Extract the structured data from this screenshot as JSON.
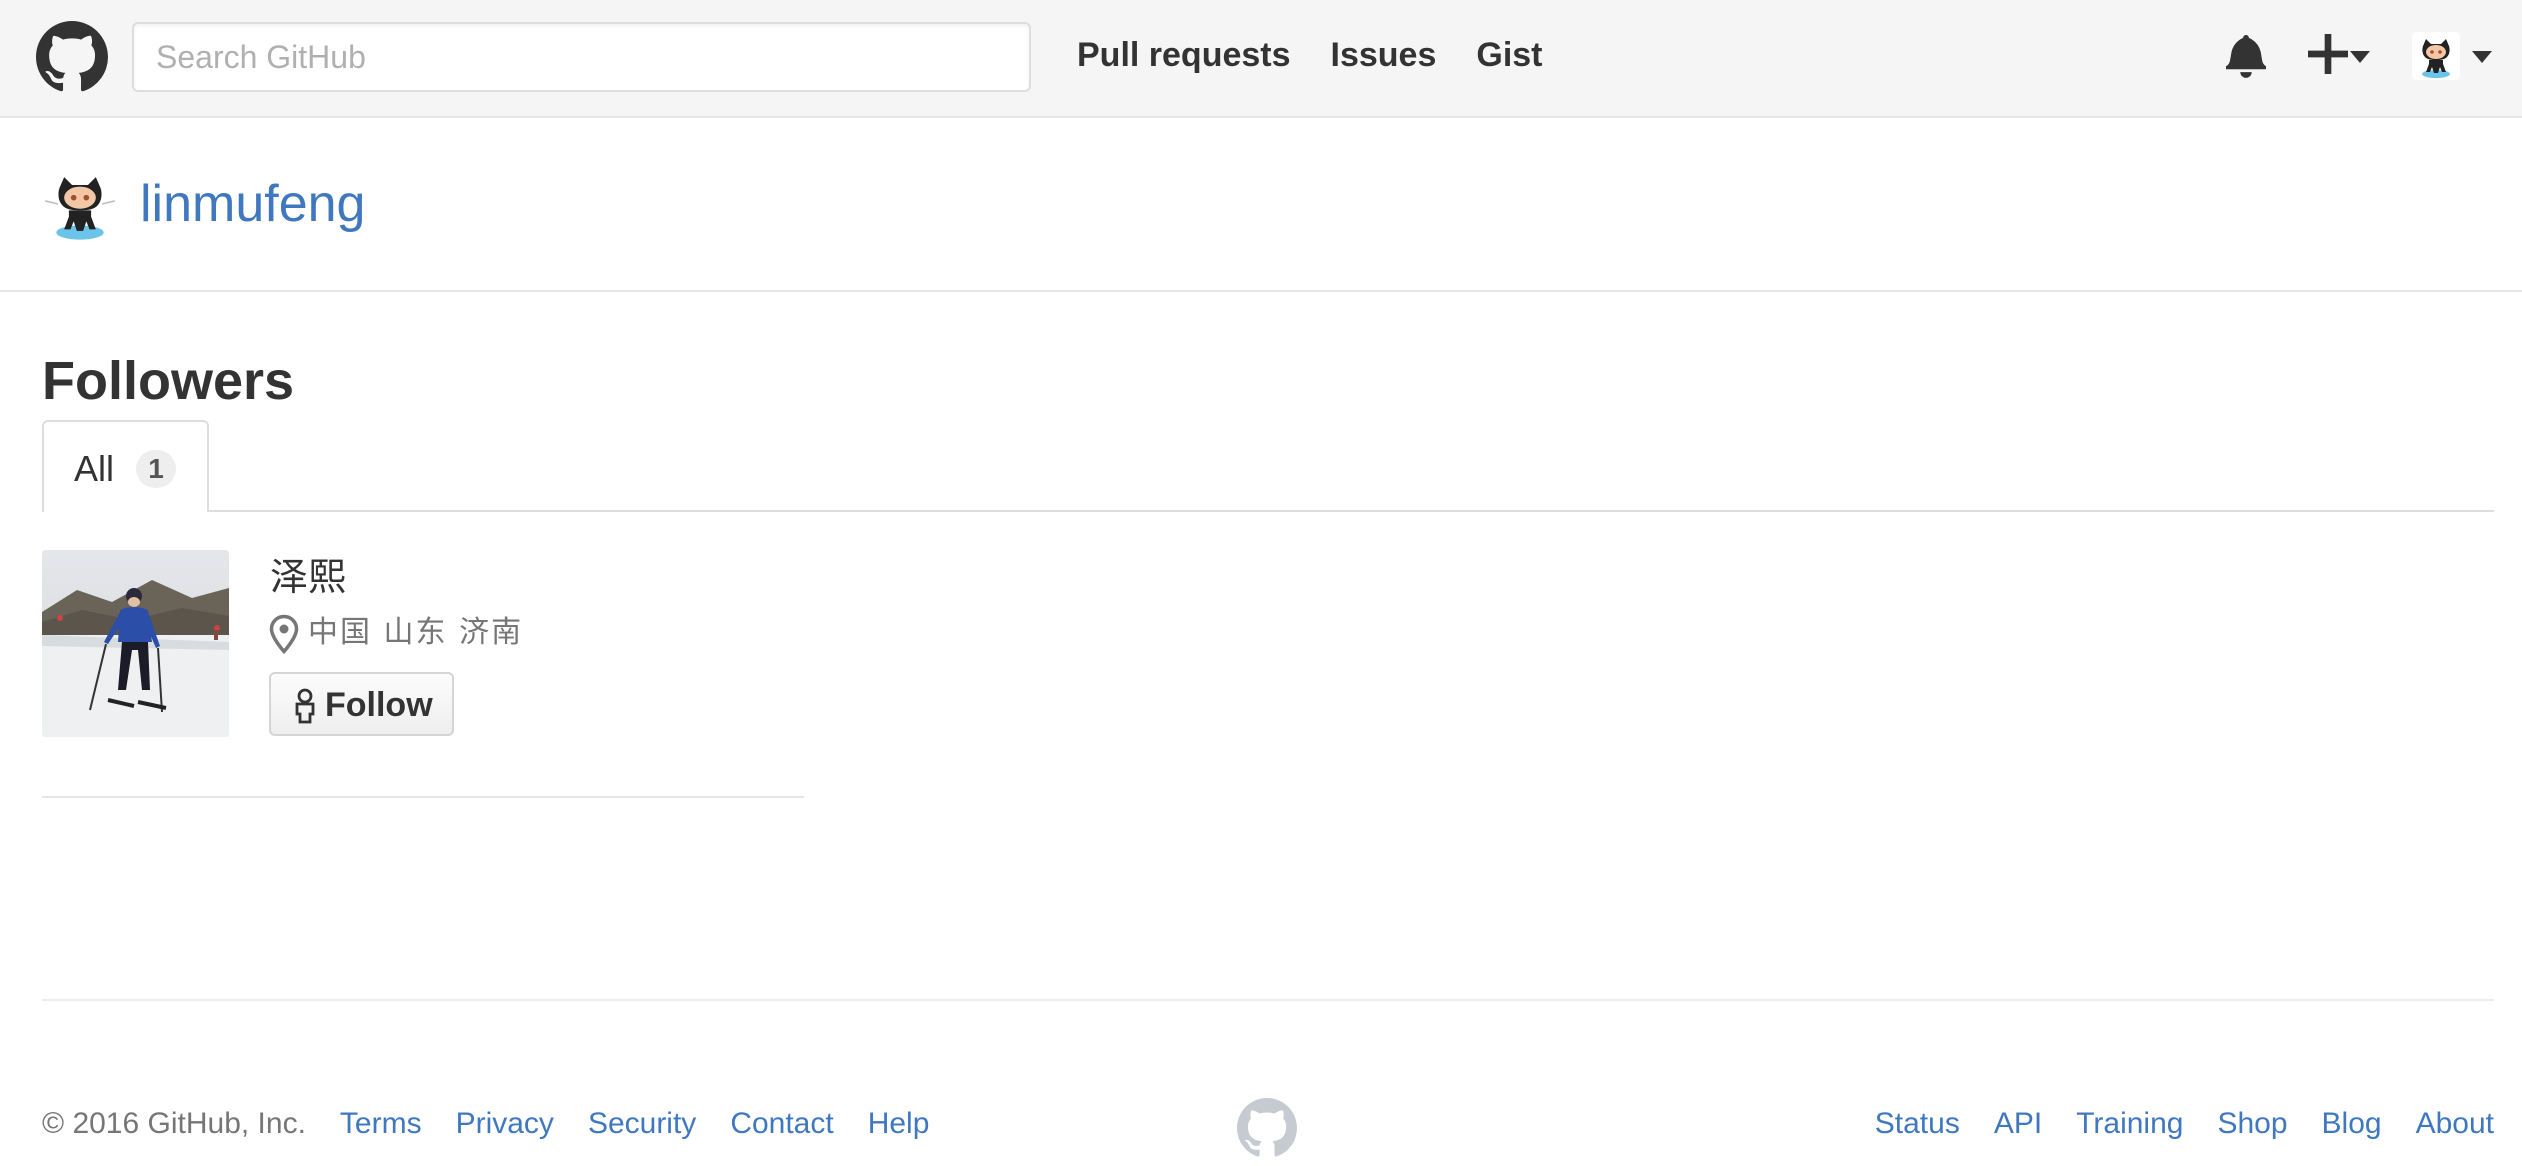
{
  "header": {
    "logo_icon": "github-octocat-icon",
    "search_placeholder": "Search GitHub",
    "nav": [
      "Pull requests",
      "Issues",
      "Gist"
    ],
    "icons": [
      "bell-icon",
      "plus-icon",
      "caret-down-icon",
      "avatar",
      "caret-down-icon"
    ]
  },
  "profile": {
    "username": "linmufeng",
    "avatar_icon": "octocat-avatar"
  },
  "followers": {
    "title": "Followers",
    "tab_label": "All",
    "tab_count": "1",
    "items": [
      {
        "name": "泽熙",
        "location": "中国 山东 济南",
        "button_label": "Follow",
        "photo": "skier-photo"
      }
    ]
  },
  "footer": {
    "copyright": "© 2016 GitHub, Inc.",
    "left_links": [
      "Terms",
      "Privacy",
      "Security",
      "Contact",
      "Help"
    ],
    "right_links": [
      "Status",
      "API",
      "Training",
      "Shop",
      "Blog",
      "About"
    ],
    "mark_icon": "github-mark-icon"
  },
  "colors": {
    "link": "#4078c0",
    "text": "#333333",
    "muted": "#767676",
    "header_bg": "#f5f5f5"
  }
}
